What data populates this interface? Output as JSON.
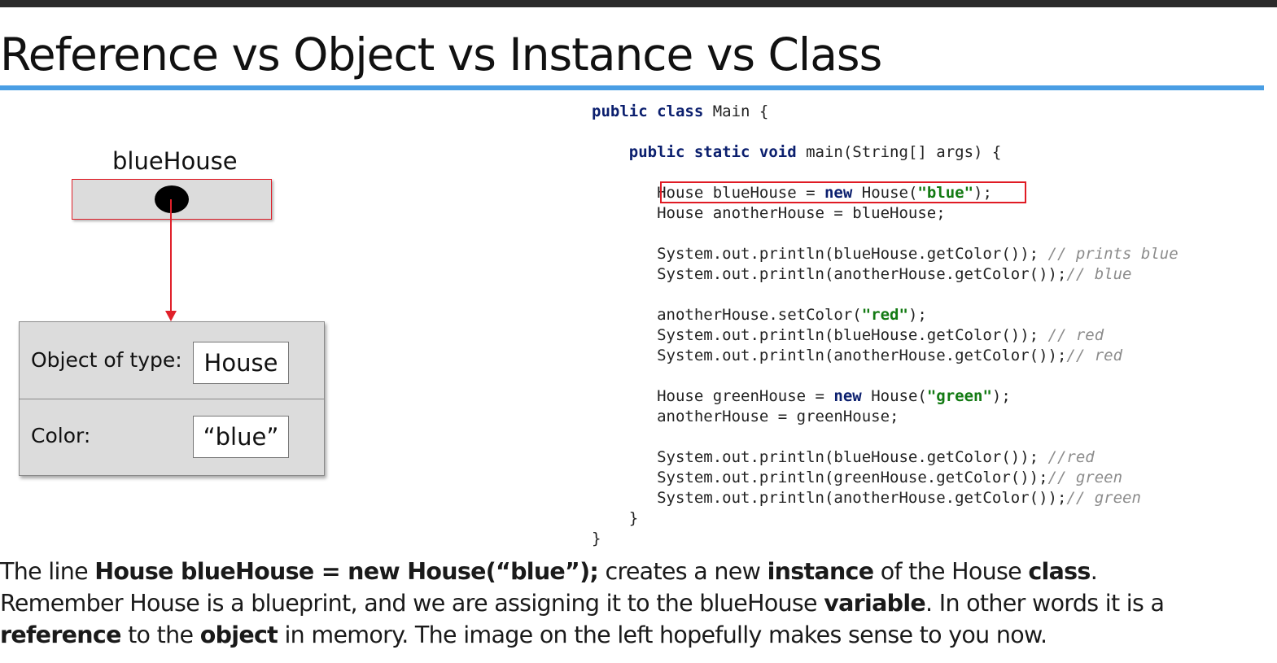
{
  "slide": {
    "title": "Reference vs Object vs Instance vs Class"
  },
  "diagram": {
    "reference_label": "blueHouse",
    "object": {
      "type_label": "Object of type:",
      "type_value": "House",
      "color_label": "Color:",
      "color_value": "“blue”"
    },
    "colors": {
      "pointer": "#e0202a",
      "box_fill": "#dcdcdc"
    }
  },
  "code": {
    "lines": [
      [
        {
          "t": "public class",
          "c": "kw"
        },
        {
          "t": " Main {"
        }
      ],
      [],
      [
        {
          "t": "    "
        },
        {
          "t": "public static void",
          "c": "kw"
        },
        {
          "t": " main(String[] args) {"
        }
      ],
      [],
      [
        {
          "t": "       House blueHouse = "
        },
        {
          "t": "new",
          "c": "kw"
        },
        {
          "t": " House("
        },
        {
          "t": "\"blue\"",
          "c": "str"
        },
        {
          "t": ");"
        }
      ],
      [
        {
          "t": "       House anotherHouse = blueHouse;"
        }
      ],
      [],
      [
        {
          "t": "       System.out.println(blueHouse.getColor()); "
        },
        {
          "t": "// prints blue",
          "c": "cm"
        }
      ],
      [
        {
          "t": "       System.out.println(anotherHouse.getColor());"
        },
        {
          "t": "// blue",
          "c": "cm"
        }
      ],
      [],
      [
        {
          "t": "       anotherHouse.setColor("
        },
        {
          "t": "\"red\"",
          "c": "str"
        },
        {
          "t": ");"
        }
      ],
      [
        {
          "t": "       System.out.println(blueHouse.getColor()); "
        },
        {
          "t": "// red",
          "c": "cm"
        }
      ],
      [
        {
          "t": "       System.out.println(anotherHouse.getColor());"
        },
        {
          "t": "// red",
          "c": "cm"
        }
      ],
      [],
      [
        {
          "t": "       House greenHouse = "
        },
        {
          "t": "new",
          "c": "kw"
        },
        {
          "t": " House("
        },
        {
          "t": "\"green\"",
          "c": "str"
        },
        {
          "t": ");"
        }
      ],
      [
        {
          "t": "       anotherHouse = greenHouse;"
        }
      ],
      [],
      [
        {
          "t": "       System.out.println(blueHouse.getColor()); "
        },
        {
          "t": "//red",
          "c": "cm"
        }
      ],
      [
        {
          "t": "       System.out.println(greenHouse.getColor());"
        },
        {
          "t": "// green",
          "c": "cm"
        }
      ],
      [
        {
          "t": "       System.out.println(anotherHouse.getColor());"
        },
        {
          "t": "// green",
          "c": "cm"
        }
      ],
      [
        {
          "t": "    }"
        }
      ],
      [
        {
          "t": "}"
        }
      ]
    ],
    "colors": {
      "keyword": "#0b1f6e",
      "string": "#137a13",
      "comment": "#8c8c8c",
      "highlight": "#e01b24"
    }
  },
  "caption": {
    "lines": [
      [
        {
          "t": "The line "
        },
        {
          "t": "House blueHouse = new House(“blue”);",
          "b": true
        },
        {
          "t": " creates a new "
        },
        {
          "t": "instance",
          "b": true
        },
        {
          "t": " of the House "
        },
        {
          "t": "class",
          "b": true
        },
        {
          "t": "."
        }
      ],
      [
        {
          "t": "Remember House is a blueprint, and we are assigning it to the blueHouse "
        },
        {
          "t": "variable",
          "b": true
        },
        {
          "t": ". In other words it is a"
        }
      ],
      [
        {
          "t": "reference",
          "b": true
        },
        {
          "t": " to the "
        },
        {
          "t": "object",
          "b": true
        },
        {
          "t": " in memory. The image on the left hopefully makes sense to you now."
        }
      ]
    ]
  }
}
